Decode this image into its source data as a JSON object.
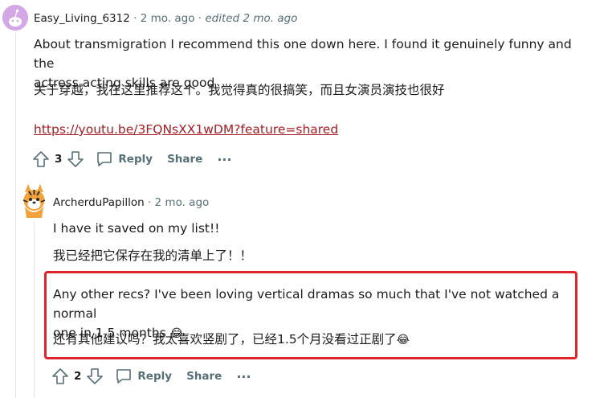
{
  "comment1": {
    "username": "Easy_Living_6312",
    "separator": "·",
    "age": "2 mo. ago",
    "edited": "edited 2 mo. ago",
    "line1": "About transmigration I recommend this one down here. I found it genuinely funny and the",
    "line2": "actress acting skills are good",
    "line3": "关于穿越，我在这里推荐这个。我觉得真的很搞笑，而且女演员演技也很好",
    "link": "https://youtu.be/3FQNsXX1wDM?feature=shared",
    "votes": "3",
    "reply": "Reply",
    "share": "Share",
    "more": "···"
  },
  "comment2": {
    "username": "ArcherduPapillon",
    "separator": "·",
    "age": "2 mo. ago",
    "line1": "I have it saved on my list!!",
    "line2": "我已经把它保存在我的清单上了！！",
    "line3": "Any other recs? I've been loving vertical dramas so much that I've not watched a normal",
    "line4": "one in 1.5 months",
    "emoji1": "😂",
    "line5": "还有其他建议吗？我太喜欢竖剧了，已经1.5个月没看过正剧了",
    "emoji2": "😂",
    "votes": "2",
    "reply": "Reply",
    "share": "Share",
    "more": "···"
  },
  "colors": {
    "meta": "#576f76",
    "link": "#a61d24",
    "highlight_border": "#e0242c",
    "avatar_bg": "#d4a8e6"
  }
}
